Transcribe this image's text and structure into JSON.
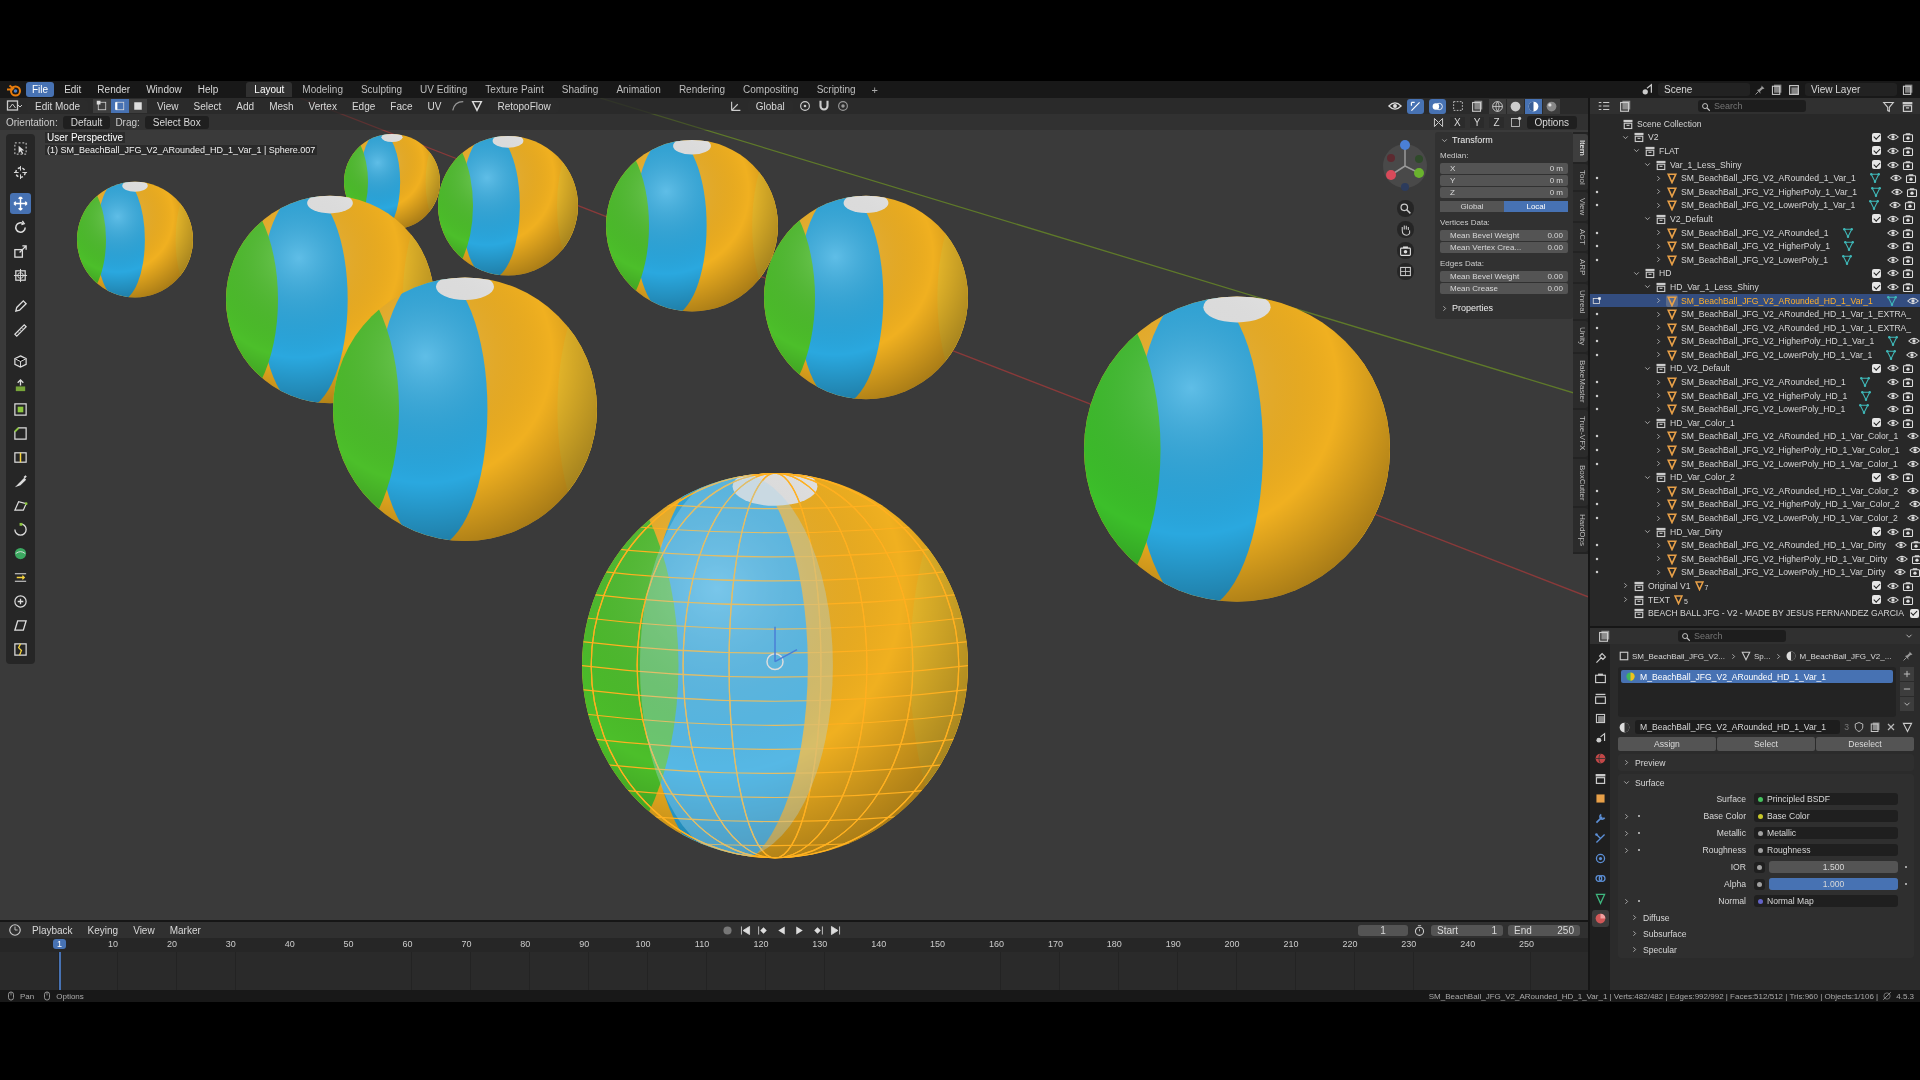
{
  "topbar": {
    "menus": [
      {
        "label": "File",
        "highlighted": true
      },
      {
        "label": "Edit",
        "highlighted": false
      },
      {
        "label": "Render",
        "highlighted": false
      },
      {
        "label": "Window",
        "highlighted": false
      },
      {
        "label": "Help",
        "highlighted": false
      }
    ],
    "workspaces": [
      {
        "label": "Layout",
        "selected": true
      },
      {
        "label": "Modeling",
        "selected": false
      },
      {
        "label": "Sculpting",
        "selected": false
      },
      {
        "label": "UV Editing",
        "selected": false
      },
      {
        "label": "Texture Paint",
        "selected": false
      },
      {
        "label": "Shading",
        "selected": false
      },
      {
        "label": "Animation",
        "selected": false
      },
      {
        "label": "Rendering",
        "selected": false
      },
      {
        "label": "Compositing",
        "selected": false
      },
      {
        "label": "Scripting",
        "selected": false
      }
    ],
    "add_workspace": "+",
    "scene": "Scene",
    "view_layer": "View Layer"
  },
  "viewport": {
    "mode": "Edit Mode",
    "select_modes": [
      {
        "kind": "vertex",
        "selected": false
      },
      {
        "kind": "edge",
        "selected": true
      },
      {
        "kind": "face",
        "selected": false
      }
    ],
    "menus": [
      "View",
      "Select",
      "Add",
      "Mesh",
      "Vertex",
      "Edge",
      "Face",
      "UV"
    ],
    "addon_menu": "RetopoFlow",
    "transform_orientation": "Global",
    "shading": [
      {
        "kind": "wireframe",
        "selected": false
      },
      {
        "kind": "solid",
        "selected": false
      },
      {
        "kind": "material",
        "selected": true
      },
      {
        "kind": "rendered",
        "selected": false
      }
    ],
    "orientation_label": "Orientation:",
    "orientation": "Default",
    "drag_label": "Drag:",
    "drag": "Select Box",
    "axes": [
      "X",
      "Y",
      "Z"
    ],
    "options": "Options",
    "view_name": "User Perspective",
    "object_info": "(1) SM_BeachBall_JFG_V2_ARounded_HD_1_Var_1 | Sphere.007",
    "tools": [
      {
        "kind": "select",
        "selected": false
      },
      {
        "kind": "cursor",
        "selected": false
      },
      {
        "kind": "move",
        "selected": true
      },
      {
        "kind": "rotate",
        "selected": false
      },
      {
        "kind": "scale",
        "selected": false
      },
      {
        "kind": "transform",
        "selected": false
      },
      {
        "kind": "annotate",
        "selected": false
      },
      {
        "kind": "measure",
        "selected": false
      },
      {
        "kind": "add_cube",
        "selected": false
      },
      {
        "kind": "extrude",
        "selected": false
      },
      {
        "kind": "inset",
        "selected": false
      },
      {
        "kind": "bevel",
        "selected": false
      },
      {
        "kind": "loop_cut",
        "selected": false
      },
      {
        "kind": "knife",
        "selected": false
      },
      {
        "kind": "poly_build",
        "selected": false
      },
      {
        "kind": "spin",
        "selected": false
      },
      {
        "kind": "smooth",
        "selected": false
      },
      {
        "kind": "edge_slide",
        "selected": false
      },
      {
        "kind": "shrink",
        "selected": false
      },
      {
        "kind": "shear",
        "selected": false
      },
      {
        "kind": "rip",
        "selected": false
      }
    ],
    "sidebar_tabs": [
      {
        "label": "Item",
        "selected": true
      },
      {
        "label": "Tool",
        "selected": false
      },
      {
        "label": "View",
        "selected": false
      },
      {
        "label": "ACT",
        "selected": false
      },
      {
        "label": "ARP",
        "selected": false
      },
      {
        "label": "Unreal",
        "selected": false
      },
      {
        "label": "Unity",
        "selected": false
      },
      {
        "label": "BakeMaster",
        "selected": false
      },
      {
        "label": "True-VFX",
        "selected": false
      },
      {
        "label": "BoxCutter",
        "selected": false
      },
      {
        "label": "HardOps",
        "selected": false
      }
    ],
    "n_panel": {
      "title": "Transform",
      "expanded": true,
      "median_label": "Median:",
      "median": [
        {
          "axis": "X",
          "value": "0 m"
        },
        {
          "axis": "Y",
          "value": "0 m"
        },
        {
          "axis": "Z",
          "value": "0 m"
        }
      ],
      "spaces": [
        {
          "label": "Global",
          "selected": false
        },
        {
          "label": "Local",
          "selected": true
        }
      ],
      "groups": [
        {
          "title": "Vertices Data:",
          "fields": [
            {
              "label": "Mean Bevel Weight",
              "value": "0.00"
            },
            {
              "label": "Mean Vertex Crea...",
              "value": "0.00"
            }
          ]
        },
        {
          "title": "Edges Data:",
          "fields": [
            {
              "label": "Mean Bevel Weight",
              "value": "0.00"
            },
            {
              "label": "Mean Crease",
              "value": "0.00"
            }
          ]
        }
      ],
      "properties": {
        "label": "Properties",
        "expanded": false
      }
    }
  },
  "timeline": {
    "menus": [
      "Playback",
      "Keying",
      "View",
      "Marker"
    ],
    "frame": "1",
    "start_label": "Start",
    "start": "1",
    "end_label": "End",
    "end": "250",
    "current_frame": "1",
    "ticks": [
      "10",
      "20",
      "30",
      "40",
      "50",
      "60",
      "70",
      "80",
      "90",
      "100",
      "110",
      "120",
      "130",
      "140",
      "150",
      "160",
      "170",
      "180",
      "190",
      "200",
      "210",
      "220",
      "230",
      "240",
      "250"
    ]
  },
  "outliner": {
    "search_placeholder": "Search",
    "tree": [
      {
        "label": "Scene Collection",
        "kind": "scene_collection",
        "selected": false,
        "children": [
          {
            "label": "V2",
            "kind": "collection",
            "expanded": true,
            "checked": true,
            "selected": false,
            "children": [
              {
                "label": "FLAT",
                "kind": "collection",
                "expanded": true,
                "checked": true,
                "selected": false,
                "children": [
                  {
                    "label": "Var_1_Less_Shiny",
                    "kind": "collection",
                    "expanded": true,
                    "checked": true,
                    "selected": false,
                    "children": [
                      {
                        "label": "SM_BeachBall_JFG_V2_ARounded_1_Var_1",
                        "kind": "mesh",
                        "expanded": false,
                        "selected": false,
                        "data_icon": true
                      },
                      {
                        "label": "SM_BeachBall_JFG_V2_HigherPoly_1_Var_1",
                        "kind": "mesh",
                        "expanded": false,
                        "selected": false,
                        "data_icon": true
                      },
                      {
                        "label": "SM_BeachBall_JFG_V2_LowerPoly_1_Var_1",
                        "kind": "mesh",
                        "expanded": false,
                        "selected": false,
                        "data_icon": true
                      }
                    ]
                  },
                  {
                    "label": "V2_Default",
                    "kind": "collection",
                    "expanded": true,
                    "checked": true,
                    "selected": false,
                    "children": [
                      {
                        "label": "SM_BeachBall_JFG_V2_ARounded_1",
                        "kind": "mesh",
                        "expanded": false,
                        "selected": false,
                        "data_icon": true
                      },
                      {
                        "label": "SM_BeachBall_JFG_V2_HigherPoly_1",
                        "kind": "mesh",
                        "expanded": false,
                        "selected": false,
                        "data_icon": true
                      },
                      {
                        "label": "SM_BeachBall_JFG_V2_LowerPoly_1",
                        "kind": "mesh",
                        "expanded": false,
                        "selected": false,
                        "data_icon": true
                      }
                    ]
                  }
                ]
              },
              {
                "label": "HD",
                "kind": "collection",
                "expanded": true,
                "checked": true,
                "selected": false,
                "children": [
                  {
                    "label": "HD_Var_1_Less_Shiny",
                    "kind": "collection",
                    "expanded": true,
                    "checked": true,
                    "selected": false,
                    "children": [
                      {
                        "label": "SM_BeachBall_JFG_V2_ARounded_HD_1_Var_1",
                        "kind": "mesh",
                        "expanded": false,
                        "selected": true,
                        "data_icon": true
                      },
                      {
                        "label": "SM_BeachBall_JFG_V2_ARounded_HD_1_Var_1_EXTRA_",
                        "kind": "mesh",
                        "expanded": false,
                        "selected": false,
                        "data_icon": false
                      },
                      {
                        "label": "SM_BeachBall_JFG_V2_ARounded_HD_1_Var_1_EXTRA_",
                        "kind": "mesh",
                        "expanded": false,
                        "selected": false,
                        "data_icon": false
                      },
                      {
                        "label": "SM_BeachBall_JFG_V2_HigherPoly_HD_1_Var_1",
                        "kind": "mesh",
                        "expanded": false,
                        "selected": false,
                        "data_icon": true
                      },
                      {
                        "label": "SM_BeachBall_JFG_V2_LowerPoly_HD_1_Var_1",
                        "kind": "mesh",
                        "expanded": false,
                        "selected": false,
                        "data_icon": true
                      }
                    ]
                  },
                  {
                    "label": "HD_V2_Default",
                    "kind": "collection",
                    "expanded": true,
                    "checked": true,
                    "selected": false,
                    "children": [
                      {
                        "label": "SM_BeachBall_JFG_V2_ARounded_HD_1",
                        "kind": "mesh",
                        "expanded": false,
                        "selected": false,
                        "data_icon": true
                      },
                      {
                        "label": "SM_BeachBall_JFG_V2_HigherPoly_HD_1",
                        "kind": "mesh",
                        "expanded": false,
                        "selected": false,
                        "data_icon": true
                      },
                      {
                        "label": "SM_BeachBall_JFG_V2_LowerPoly_HD_1",
                        "kind": "mesh",
                        "expanded": false,
                        "selected": false,
                        "data_icon": true
                      }
                    ]
                  },
                  {
                    "label": "HD_Var_Color_1",
                    "kind": "collection",
                    "expanded": true,
                    "checked": true,
                    "selected": false,
                    "children": [
                      {
                        "label": "SM_BeachBall_JFG_V2_ARounded_HD_1_Var_Color_1",
                        "kind": "mesh",
                        "expanded": false,
                        "selected": false,
                        "data_icon": false
                      },
                      {
                        "label": "SM_BeachBall_JFG_V2_HigherPoly_HD_1_Var_Color_1",
                        "kind": "mesh",
                        "expanded": false,
                        "selected": false,
                        "data_icon": false
                      },
                      {
                        "label": "SM_BeachBall_JFG_V2_LowerPoly_HD_1_Var_Color_1",
                        "kind": "mesh",
                        "expanded": false,
                        "selected": false,
                        "data_icon": false
                      }
                    ]
                  },
                  {
                    "label": "HD_Var_Color_2",
                    "kind": "collection",
                    "expanded": true,
                    "checked": true,
                    "selected": false,
                    "children": [
                      {
                        "label": "SM_BeachBall_JFG_V2_ARounded_HD_1_Var_Color_2",
                        "kind": "mesh",
                        "expanded": false,
                        "selected": false,
                        "data_icon": false
                      },
                      {
                        "label": "SM_BeachBall_JFG_V2_HigherPoly_HD_1_Var_Color_2",
                        "kind": "mesh",
                        "expanded": false,
                        "selected": false,
                        "data_icon": false
                      },
                      {
                        "label": "SM_BeachBall_JFG_V2_LowerPoly_HD_1_Var_Color_2",
                        "kind": "mesh",
                        "expanded": false,
                        "selected": false,
                        "data_icon": false
                      }
                    ]
                  },
                  {
                    "label": "HD_Var_Dirty",
                    "kind": "collection",
                    "expanded": true,
                    "checked": true,
                    "selected": false,
                    "children": [
                      {
                        "label": "SM_BeachBall_JFG_V2_ARounded_HD_1_Var_Dirty",
                        "kind": "mesh",
                        "expanded": false,
                        "selected": false,
                        "data_icon": false
                      },
                      {
                        "label": "SM_BeachBall_JFG_V2_HigherPoly_HD_1_Var_Dirty",
                        "kind": "mesh",
                        "expanded": false,
                        "selected": false,
                        "data_icon": false
                      },
                      {
                        "label": "SM_BeachBall_JFG_V2_LowerPoly_HD_1_Var_Dirty",
                        "kind": "mesh",
                        "expanded": false,
                        "selected": false,
                        "data_icon": false
                      }
                    ]
                  }
                ]
              }
            ]
          },
          {
            "label": "Original V1",
            "kind": "collection",
            "expanded": false,
            "checked": true,
            "selected": false,
            "count": "7"
          },
          {
            "label": "TEXT",
            "kind": "collection",
            "expanded": false,
            "checked": true,
            "selected": false,
            "count": "5"
          },
          {
            "label": "BEACH BALL JFG - V2 -  MADE BY JESUS FERNANDEZ GARCIA",
            "kind": "collection",
            "checked": true,
            "selected": false
          }
        ]
      }
    ]
  },
  "properties": {
    "search_placeholder": "Search",
    "tabs": [
      {
        "kind": "tool",
        "selected": false
      },
      {
        "kind": "render",
        "selected": false
      },
      {
        "kind": "output",
        "selected": false
      },
      {
        "kind": "view_layer",
        "selected": false
      },
      {
        "kind": "scene",
        "selected": false
      },
      {
        "kind": "world",
        "selected": false
      },
      {
        "kind": "collection",
        "selected": false
      },
      {
        "kind": "object",
        "selected": false
      },
      {
        "kind": "modifiers",
        "selected": false
      },
      {
        "kind": "particles",
        "selected": false
      },
      {
        "kind": "physics",
        "selected": false
      },
      {
        "kind": "constraints",
        "selected": false
      },
      {
        "kind": "data",
        "selected": false
      },
      {
        "kind": "material",
        "selected": true
      }
    ],
    "breadcrumb": [
      "SM_BeachBall_JFG_V2...",
      "Sp...",
      "M_BeachBall_JFG_V2_..."
    ],
    "slots": [
      {
        "label": "M_BeachBall_JFG_V2_ARounded_HD_1_Var_1",
        "selected": true
      }
    ],
    "material_name": "M_BeachBall_JFG_V2_ARounded_HD_1_Var_1",
    "users": "3",
    "slot_buttons": [
      "Assign",
      "Select",
      "Deselect"
    ],
    "panels": [
      {
        "label": "Preview",
        "expanded": false
      },
      {
        "label": "Surface",
        "expanded": true,
        "inputs": [
          {
            "kind": "link",
            "label": "Surface",
            "value": "Principled BSDF",
            "color": "#45c25e",
            "expandable": false
          },
          {
            "kind": "link",
            "label": "Base Color",
            "value": "Base Color",
            "color": "#c7c729",
            "expandable": true
          },
          {
            "kind": "link",
            "label": "Metallic",
            "value": "Metallic",
            "color": "#a1a1a1",
            "expandable": true
          },
          {
            "kind": "link",
            "label": "Roughness",
            "value": "Roughness",
            "color": "#a1a1a1",
            "expandable": true
          },
          {
            "kind": "number",
            "label": "IOR",
            "value": "1.500"
          },
          {
            "kind": "slider",
            "label": "Alpha",
            "value": "1.000",
            "level": 1
          },
          {
            "kind": "link",
            "label": "Normal",
            "value": "Normal Map",
            "color": "#6363c7",
            "expandable": true
          }
        ],
        "subpanels": [
          {
            "label": "Diffuse",
            "expanded": false
          },
          {
            "label": "Subsurface",
            "expanded": false
          },
          {
            "label": "Specular",
            "expanded": false
          }
        ]
      }
    ]
  },
  "status_bar": {
    "hints": [
      "Pan",
      "Options"
    ],
    "stats": "SM_BeachBall_JFG_V2_ARounded_HD_1_Var_1 | Verts:482/482 | Edges:992/992 | Faces:512/512 | Tris:960 | Objects:1/106 |",
    "version": "4.5.3"
  }
}
